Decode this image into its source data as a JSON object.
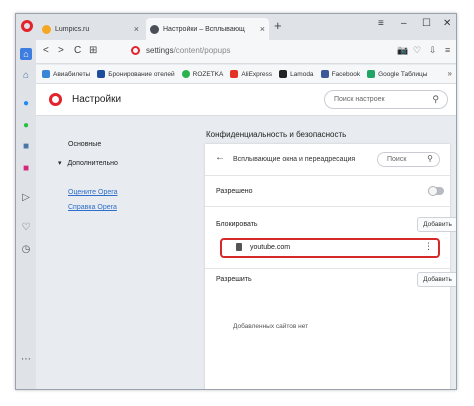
{
  "window": {
    "tabs": [
      {
        "title": "Lumpics.ru",
        "close": "×"
      },
      {
        "title": "Настройки – Всплывающ",
        "close": "×"
      }
    ],
    "new_tab": "+",
    "controls": {
      "minimize": "–",
      "restore": "☐",
      "close": "✕",
      "menu": "≡"
    }
  },
  "addressbar": {
    "back": "<",
    "forward": ">",
    "reload": "C",
    "grid": "⊞",
    "url_host": "settings",
    "url_path": "/content/popups",
    "right_icons": [
      "📷",
      "♡",
      "⇩",
      "≡"
    ]
  },
  "bookmarks": {
    "items": [
      {
        "label": "Авиабилеты",
        "color": "#3a86d6"
      },
      {
        "label": "Бронирование отелей",
        "color": "#1d4e9e"
      },
      {
        "label": "ROZETKA",
        "color": "#2bb24c"
      },
      {
        "label": "AliExpress",
        "color": "#e43225"
      },
      {
        "label": "Lamoda",
        "color": "#222222"
      },
      {
        "label": "Facebook",
        "color": "#3b5998"
      },
      {
        "label": "Google Таблицы",
        "color": "#21a464"
      }
    ],
    "more": "»"
  },
  "settings": {
    "title": "Настройки",
    "search_placeholder": "Поиск настроек",
    "menu": {
      "basic": "Основные",
      "advanced": "Дополнительно",
      "advanced_caret": "▾",
      "rate_opera": "Оцените Opera",
      "help_opera": "Справка Opera"
    },
    "section_title": "Конфиденциальность и безопасность",
    "popups": {
      "title": "Всплывающие окна и переадресация",
      "search_placeholder": "Поиск",
      "allowed_label": "Разрешено",
      "allowed_state": false,
      "block_label": "Блокировать",
      "add_button": "Добавить",
      "blocked_sites": [
        {
          "host": "youtube.com",
          "menu": "⋮"
        }
      ],
      "allow_label": "Разрешить",
      "allow_add_button": "Добавить",
      "allow_empty_text": "Добавленных сайтов нет"
    }
  },
  "colors": {
    "accent": "#e3232b",
    "highlight": "#d62a2a",
    "link": "#2f6fc9"
  }
}
